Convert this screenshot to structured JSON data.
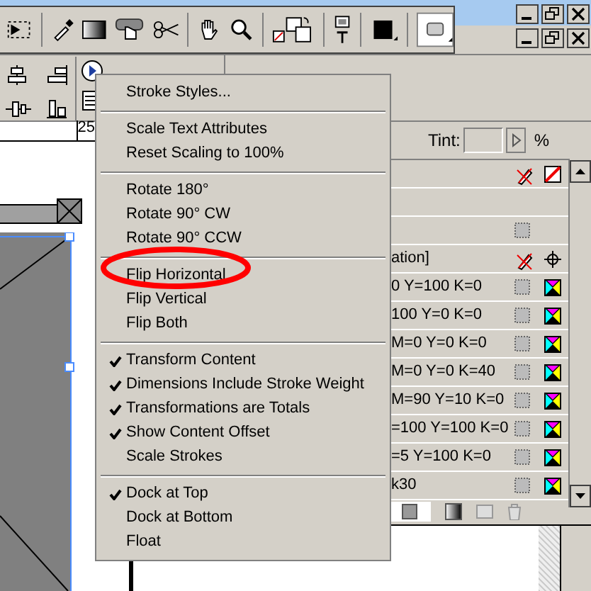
{
  "ruler": {
    "mark": "25"
  },
  "swatches": {
    "tint_label": "Tint:",
    "tint_unit": "%",
    "rows": [
      {
        "kind": "header"
      },
      {
        "kind": "blank"
      },
      {
        "kind": "paper"
      },
      {
        "kind": "registration",
        "name": "ation]"
      },
      {
        "kind": "process",
        "name": "0 Y=100 K=0"
      },
      {
        "kind": "process",
        "name": "100 Y=0 K=0"
      },
      {
        "kind": "process",
        "name": "M=0 Y=0 K=0"
      },
      {
        "kind": "process",
        "name": "M=0 Y=0 K=40"
      },
      {
        "kind": "process",
        "name": "M=90 Y=10 K=0"
      },
      {
        "kind": "process",
        "name": "=100 Y=100 K=0"
      },
      {
        "kind": "process",
        "name": "=5 Y=100 K=0"
      },
      {
        "kind": "process",
        "name": "k30"
      }
    ]
  },
  "menu": {
    "groups": [
      [
        {
          "label": "Stroke Styles...",
          "checked": false
        }
      ],
      [
        {
          "label": "Scale Text Attributes",
          "checked": false
        },
        {
          "label": "Reset Scaling to 100%",
          "checked": false
        }
      ],
      [
        {
          "label": "Rotate 180°",
          "checked": false
        },
        {
          "label": "Rotate 90° CW",
          "checked": false
        },
        {
          "label": "Rotate 90° CCW",
          "checked": false
        }
      ],
      [
        {
          "label": "Flip Horizontal",
          "checked": false
        },
        {
          "label": "Flip Vertical",
          "checked": false
        },
        {
          "label": "Flip Both",
          "checked": false
        }
      ],
      [
        {
          "label": "Transform Content",
          "checked": true
        },
        {
          "label": "Dimensions Include Stroke Weight",
          "checked": true
        },
        {
          "label": "Transformations are Totals",
          "checked": true
        },
        {
          "label": "Show Content Offset",
          "checked": true
        },
        {
          "label": "Scale Strokes",
          "checked": false
        }
      ],
      [
        {
          "label": "Dock at Top",
          "checked": true
        },
        {
          "label": "Dock at Bottom",
          "checked": false
        },
        {
          "label": "Float",
          "checked": false
        }
      ]
    ]
  }
}
